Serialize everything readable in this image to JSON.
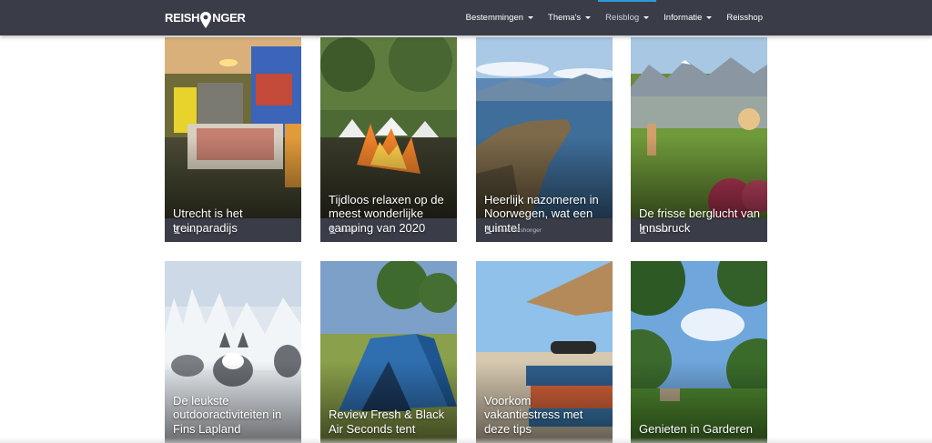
{
  "brand": {
    "name_left": "REISH",
    "name_right": "NGER"
  },
  "nav": [
    {
      "label": "Bestemmingen",
      "dropdown": true
    },
    {
      "label": "Thema's",
      "dropdown": true
    },
    {
      "label": "Reisblog",
      "dropdown": true,
      "active": true
    },
    {
      "label": "Informatie",
      "dropdown": true
    },
    {
      "label": "Reisshop",
      "dropdown": false
    }
  ],
  "cards": [
    {
      "title": "Utrecht is het treinparadijs",
      "author": "Jos"
    },
    {
      "title": "Tijdloos relaxen op de meest wonderlijke camping van 2020",
      "author": "Martijn"
    },
    {
      "title": "Heerlijk nazomeren in Noorwegen, wat een ruimte!",
      "author": "Team Reishonger"
    },
    {
      "title": "De frisse berglucht van Innsbruck",
      "author": "Dionne"
    },
    {
      "title": "De leukste outdooractiviteiten in Fins Lapland"
    },
    {
      "title": "Review Fresh & Black Air Seconds tent"
    },
    {
      "title": "Voorkom vakantiestress met deze tips"
    },
    {
      "title": "Genieten in Garderen"
    }
  ],
  "colors": {
    "nav_bg": "#3a3d48",
    "active_bar": "#2f9ad8",
    "meta_text": "#b9bcc4"
  }
}
